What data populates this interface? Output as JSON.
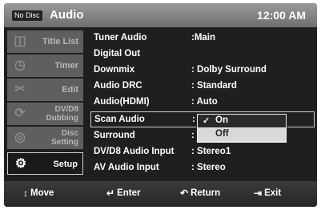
{
  "header": {
    "no_disc": "No Disc",
    "title": "Audio",
    "clock": "12:00 AM"
  },
  "sidebar": {
    "items": [
      {
        "label": "Title List",
        "icon": "film-icon"
      },
      {
        "label": "Timer",
        "icon": "clock-icon"
      },
      {
        "label": "Edit",
        "icon": "scissors-icon"
      },
      {
        "label": "DV/D8\nDubbing",
        "icon": "dubbing-icon"
      },
      {
        "label": "Disc\nSetting",
        "icon": "disc-icon"
      },
      {
        "label": "Setup",
        "icon": "gear-icon",
        "active": true
      }
    ]
  },
  "settings": [
    {
      "key": "Tuner Audio",
      "value": ":Main"
    },
    {
      "key": "Digital Out",
      "value": ""
    },
    {
      "key": "Downmix",
      "value": ": Dolby Surround"
    },
    {
      "key": "Audio DRC",
      "value": ": Standard"
    },
    {
      "key": "Audio(HDMI)",
      "value": ": Auto"
    },
    {
      "key": "Scan Audio",
      "value": ":"
    },
    {
      "key": "Surround",
      "value": ":"
    },
    {
      "key": "DV/D8 Audio Input",
      "value": ": Stereo1"
    },
    {
      "key": "AV Audio Input",
      "value": ": Stereo"
    }
  ],
  "dropdown": {
    "options": [
      "On",
      "Off"
    ],
    "selected": "On",
    "check": "✓"
  },
  "footer": {
    "move": "Move",
    "enter": "Enter",
    "return": "Return",
    "exit": "Exit",
    "move_icon": "↕",
    "enter_icon": "↵",
    "return_icon": "↶",
    "exit_icon": "⇥"
  }
}
